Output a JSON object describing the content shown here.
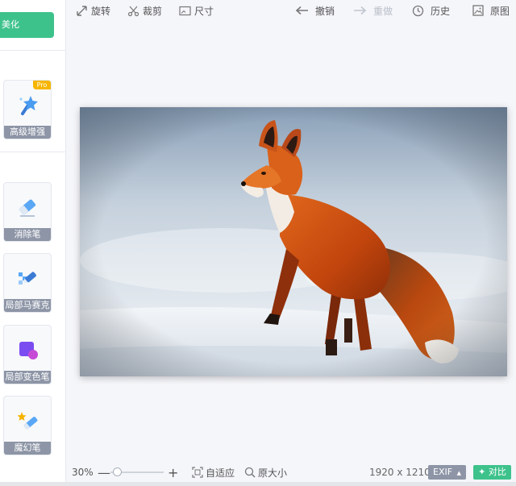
{
  "sidebar": {
    "beautify_label": "美化",
    "tools": [
      {
        "label": "高级增强",
        "badge": "Pro"
      },
      {
        "label": "消除笔"
      },
      {
        "label": "局部马赛克"
      },
      {
        "label": "局部变色笔"
      },
      {
        "label": "魔幻笔"
      }
    ]
  },
  "toolbar": {
    "rotate": "旋转",
    "crop": "裁剪",
    "size": "尺寸",
    "undo": "撤销",
    "redo": "重做",
    "history": "历史",
    "original": "原图"
  },
  "bottom": {
    "zoom": "30%",
    "zoom_minus": "—",
    "zoom_plus": "+",
    "zoom_level": 0.3,
    "fit": "自适应",
    "actual_size": "原大小",
    "dimensions": "1920 x 1210",
    "exif": "EXIF",
    "compare": "对比"
  },
  "colors": {
    "accent": "#3ec28c",
    "label_bg": "#8d95a6",
    "pro_badge": "#f7b500"
  },
  "icons": [
    "rotate-icon",
    "crop-icon",
    "size-icon",
    "undo-icon",
    "redo-icon",
    "history-icon",
    "original-image-icon",
    "fit-icon",
    "zoom-icon",
    "compare-icon"
  ]
}
